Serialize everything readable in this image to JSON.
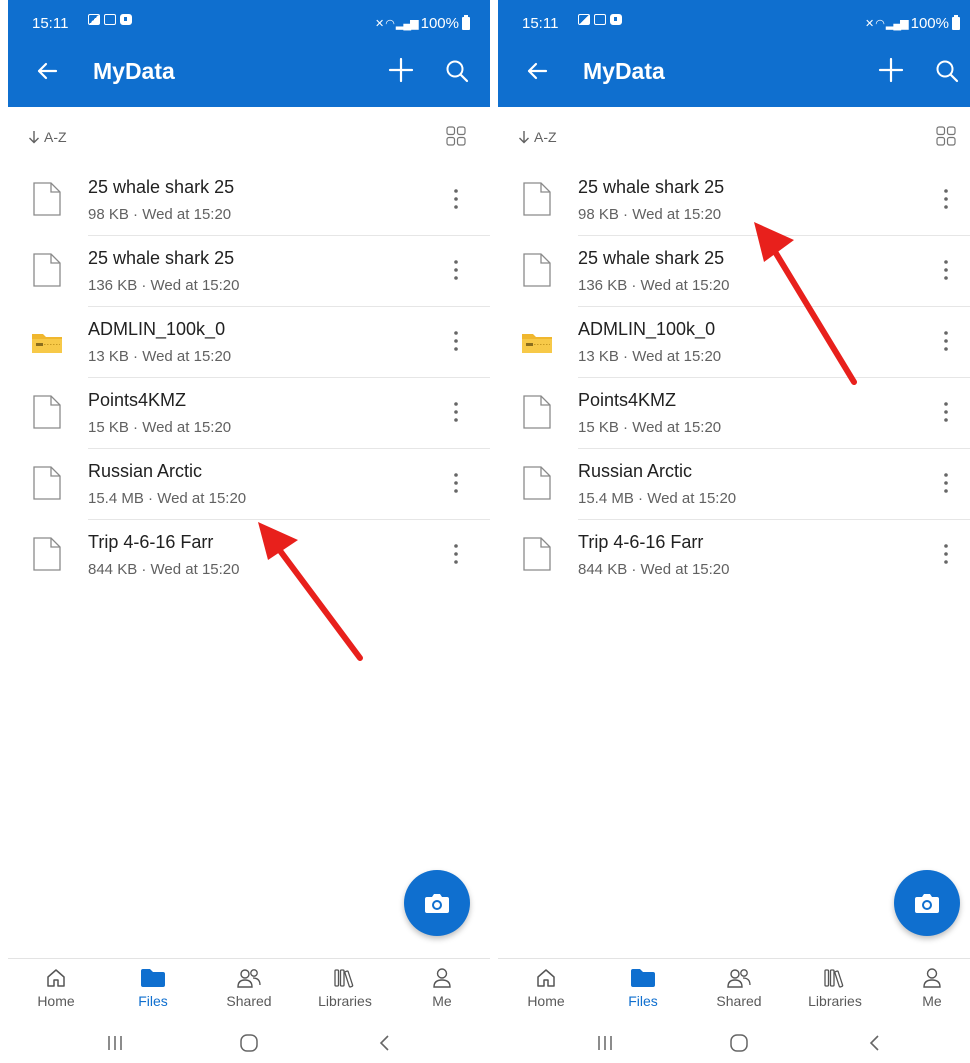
{
  "status_bar": {
    "time": "15:11",
    "battery": "100%"
  },
  "appbar": {
    "title": "MyData"
  },
  "sort": {
    "label": "A-Z"
  },
  "files": [
    {
      "name": "25 whale shark 25",
      "meta": "98 KB · Wed at 15:20",
      "icon": "file-icon"
    },
    {
      "name": "25 whale shark 25",
      "meta": "136 KB · Wed at 15:20",
      "icon": "file-icon"
    },
    {
      "name": "ADMLIN_100k_0",
      "meta": "13 KB · Wed at 15:20",
      "icon": "zip-folder-icon"
    },
    {
      "name": "Points4KMZ",
      "meta": "15 KB · Wed at 15:20",
      "icon": "file-icon"
    },
    {
      "name": "Russian Arctic",
      "meta": "15.4 MB · Wed at 15:20",
      "icon": "file-icon"
    },
    {
      "name": "Trip 4-6-16 Farr",
      "meta": "844 KB · Wed at 15:20",
      "icon": "file-icon"
    }
  ],
  "bottom_nav": {
    "home": "Home",
    "files": "Files",
    "shared": "Shared",
    "libraries": "Libraries",
    "me": "Me"
  },
  "colors": {
    "brand": "#0f6fcf",
    "annotation_arrow": "#e8201c"
  }
}
